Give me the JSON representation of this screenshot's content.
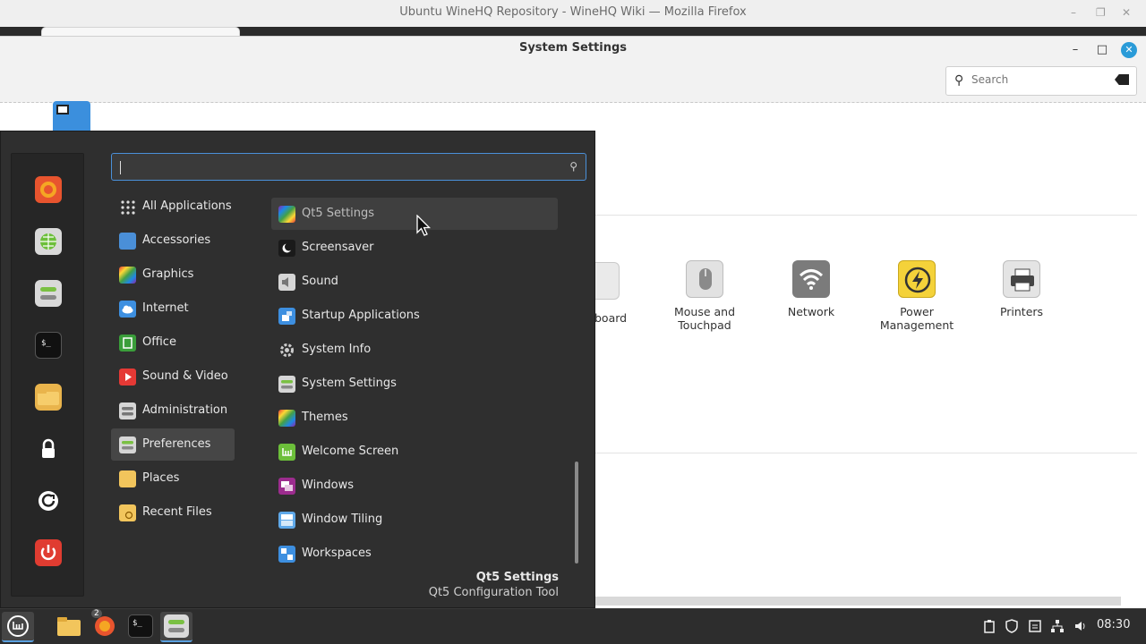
{
  "firefox": {
    "window_title": "Ubuntu WineHQ Repository - WineHQ Wiki — Mozilla Firefox",
    "controls": {
      "minimize": "–",
      "maximize": "❐",
      "close": "✕"
    }
  },
  "settings": {
    "window_title": "System Settings",
    "controls": {
      "minimize": "–",
      "maximize": "□",
      "close": "✕"
    },
    "search_placeholder": "Search",
    "items": [
      {
        "label": "board"
      },
      {
        "label": "Mouse and Touchpad",
        "icon": "mouse-icon"
      },
      {
        "label": "Network",
        "icon": "wifi-icon"
      },
      {
        "label": "Power Management",
        "icon": "power-bolt-icon"
      },
      {
        "label": "Printers",
        "icon": "printer-icon"
      }
    ]
  },
  "menu": {
    "search_value": "",
    "favorites": [
      "firefox-icon",
      "software-manager-icon",
      "system-settings-icon",
      "terminal-icon",
      "files-icon",
      "lock-screen-icon",
      "logout-icon",
      "shutdown-icon"
    ],
    "categories": [
      {
        "label": "All Applications",
        "icon": "grid-icon"
      },
      {
        "label": "Accessories",
        "icon": "accessories-icon"
      },
      {
        "label": "Graphics",
        "icon": "graphics-icon"
      },
      {
        "label": "Internet",
        "icon": "cloud-icon"
      },
      {
        "label": "Office",
        "icon": "office-icon"
      },
      {
        "label": "Sound & Video",
        "icon": "media-play-icon"
      },
      {
        "label": "Administration",
        "icon": "administration-icon"
      },
      {
        "label": "Preferences",
        "icon": "preferences-icon",
        "selected": true
      },
      {
        "label": "Places",
        "icon": "folder-icon"
      },
      {
        "label": "Recent Files",
        "icon": "recent-folder-icon"
      }
    ],
    "apps": [
      {
        "label": "Qt5 Settings",
        "icon": "qt5-settings-icon",
        "hovered": true
      },
      {
        "label": "Screensaver",
        "icon": "screensaver-icon"
      },
      {
        "label": "Sound",
        "icon": "speaker-icon"
      },
      {
        "label": "Startup Applications",
        "icon": "startup-icon"
      },
      {
        "label": "System Info",
        "icon": "gear-icon"
      },
      {
        "label": "System Settings",
        "icon": "system-settings-icon"
      },
      {
        "label": "Themes",
        "icon": "themes-icon"
      },
      {
        "label": "Welcome Screen",
        "icon": "mint-logo-icon"
      },
      {
        "label": "Windows",
        "icon": "windows-icon"
      },
      {
        "label": "Window Tiling",
        "icon": "window-tiling-icon"
      },
      {
        "label": "Workspaces",
        "icon": "workspaces-icon"
      }
    ],
    "description": {
      "title": "Qt5 Settings",
      "subtitle": "Qt5 Configuration Tool"
    }
  },
  "taskbar": {
    "items": [
      "mint-menu-icon",
      "files-icon",
      "firefox-icon",
      "terminal-icon",
      "system-settings-icon"
    ],
    "firefox_badge": "2",
    "clock": "08:30",
    "tray": [
      "clipboard-icon",
      "shield-icon",
      "notes-icon",
      "network-icon",
      "volume-icon"
    ]
  },
  "colors": {
    "accent": "#4a90d9",
    "menu_bg": "#2f2f2f",
    "panel_bg": "#2d2d2d",
    "close_blue": "#2a9bd8"
  }
}
